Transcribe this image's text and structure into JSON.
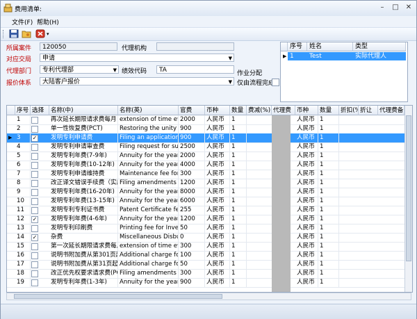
{
  "window": {
    "title": "费用清单:"
  },
  "menu": {
    "file": "文件(F)",
    "help": "帮助(H)"
  },
  "form": {
    "case_label": "所属案件",
    "case_value": "120050",
    "agency_label": "代理机构",
    "agency_value": "",
    "stage_label": "对应交局",
    "stage_value": "申请",
    "dept_label": "代理部门",
    "dept_value": "专利代理部",
    "perf_label": "绩效代码",
    "perf_value": "TA",
    "pricing_label": "报价体系",
    "pricing_value": "大陆客户报价",
    "work_assign_label": "作业分配",
    "flow_only_label": "仅由流程完成"
  },
  "agent_grid": {
    "headers": [
      "序号",
      "姓名",
      "类型"
    ],
    "rows": [
      {
        "no": "1",
        "name": "Test",
        "type": "实际代理人"
      }
    ]
  },
  "fee_grid": {
    "headers": [
      "序号",
      "选择",
      "名称(中)",
      "名称(英)",
      "官费",
      "币种",
      "数量",
      "费减(%)",
      "代理费",
      "币种",
      "数量",
      "折扣(%)",
      "折让",
      "代理费备"
    ],
    "rows": [
      {
        "no": "1",
        "checked": false,
        "cn": "再次延长期限请求费每月",
        "en": "extension of time ever",
        "fee": "2000",
        "cur": "人民币",
        "qty": "1",
        "cur2": "人民币",
        "qty2": "1"
      },
      {
        "no": "2",
        "checked": false,
        "cn": "单一性恢复费(PCT)",
        "en": "Restoring the unity fo",
        "fee": "900",
        "cur": "人民币",
        "qty": "1",
        "cur2": "人民币",
        "qty2": "1"
      },
      {
        "no": "3",
        "checked": true,
        "cn": "发明专利申请费",
        "en": "Filing an application fo",
        "fee": "900",
        "cur": "人民币",
        "qty": "1",
        "cur2": "人民币",
        "qty2": "1"
      },
      {
        "no": "4",
        "checked": false,
        "cn": "发明专利申请审查费",
        "en": "Filing request for subs",
        "fee": "2500",
        "cur": "人民币",
        "qty": "1",
        "cur2": "人民币",
        "qty2": "1"
      },
      {
        "no": "5",
        "checked": false,
        "cn": "发明专利年费(7-9年)",
        "en": "Annuity for the year in",
        "fee": "2000",
        "cur": "人民币",
        "qty": "1",
        "cur2": "人民币",
        "qty2": "1"
      },
      {
        "no": "6",
        "checked": false,
        "cn": "发明专利年费(10-12年)",
        "en": "Annuity for the year in",
        "fee": "4000",
        "cur": "人民币",
        "qty": "1",
        "cur2": "人民币",
        "qty2": "1"
      },
      {
        "no": "7",
        "checked": false,
        "cn": "发明专利申请维持费",
        "en": "Maintenance fee for In",
        "fee": "300",
        "cur": "人民币",
        "qty": "1",
        "cur2": "人民币",
        "qty2": "1"
      },
      {
        "no": "8",
        "checked": false,
        "cn": "改正译文错误手续费（实质",
        "en": "Filing amendments to",
        "fee": "1200",
        "cur": "人民币",
        "qty": "1",
        "cur2": "人民币",
        "qty2": "1"
      },
      {
        "no": "9",
        "checked": false,
        "cn": "发明专利年费(16-20年)",
        "en": "Annuity for the year in",
        "fee": "8000",
        "cur": "人民币",
        "qty": "1",
        "cur2": "人民币",
        "qty2": "1"
      },
      {
        "no": "10",
        "checked": false,
        "cn": "发明专利年费(13-15年)",
        "en": "Annuity for the year in",
        "fee": "6000",
        "cur": "人民币",
        "qty": "1",
        "cur2": "人民币",
        "qty2": "1"
      },
      {
        "no": "11",
        "checked": false,
        "cn": "发明专利专利证书费",
        "en": "Patent Certificate fee",
        "fee": "255",
        "cur": "人民币",
        "qty": "1",
        "cur2": "人民币",
        "qty2": "1"
      },
      {
        "no": "12",
        "checked": true,
        "cn": "发明专利年费(4-6年)",
        "en": "Annuity for the year in",
        "fee": "1200",
        "cur": "人民币",
        "qty": "1",
        "cur2": "人民币",
        "qty2": "1"
      },
      {
        "no": "13",
        "checked": false,
        "cn": "发明专利印刷费",
        "en": "Printing fee for Invent",
        "fee": "50",
        "cur": "人民币",
        "qty": "1",
        "cur2": "人民币",
        "qty2": "1"
      },
      {
        "no": "14",
        "checked": true,
        "cn": "杂费",
        "en": "Miscellaneous Disburs",
        "fee": "0",
        "cur": "人民币",
        "qty": "1",
        "cur2": "人民币",
        "qty2": "1"
      },
      {
        "no": "15",
        "checked": false,
        "cn": "第一次延长期限请求费每月",
        "en": "extension of time ever",
        "fee": "300",
        "cur": "人民币",
        "qty": "1",
        "cur2": "人民币",
        "qty2": "1"
      },
      {
        "no": "16",
        "checked": false,
        "cn": "说明书附加费从第301页起",
        "en": "Additional charge for",
        "fee": "100",
        "cur": "人民币",
        "qty": "1",
        "cur2": "人民币",
        "qty2": "1"
      },
      {
        "no": "17",
        "checked": false,
        "cn": "说明书附加费从第31页起每",
        "en": "Additional charge for",
        "fee": "50",
        "cur": "人民币",
        "qty": "1",
        "cur2": "人民币",
        "qty2": "1"
      },
      {
        "no": "18",
        "checked": false,
        "cn": "改正优先权要求请求费(PCT",
        "en": "Filing amendments to",
        "fee": "300",
        "cur": "人民币",
        "qty": "1",
        "cur2": "人民币",
        "qty2": "1"
      },
      {
        "no": "19",
        "checked": false,
        "cn": "发明专利年费(1-3年)",
        "en": "Annuity for the year in",
        "fee": "900",
        "cur": "人民币",
        "qty": "1",
        "cur2": "人民币",
        "qty2": "1"
      }
    ],
    "selected_index": 2
  },
  "icons": {
    "app": "app-icon",
    "save": "save-icon",
    "open": "folder-icon",
    "delete": "delete-icon",
    "minimize": "minimize-icon",
    "maximize": "maximize-icon",
    "close": "close-icon"
  },
  "colors": {
    "selection": "#3399ff",
    "label_red": "#c00000"
  }
}
